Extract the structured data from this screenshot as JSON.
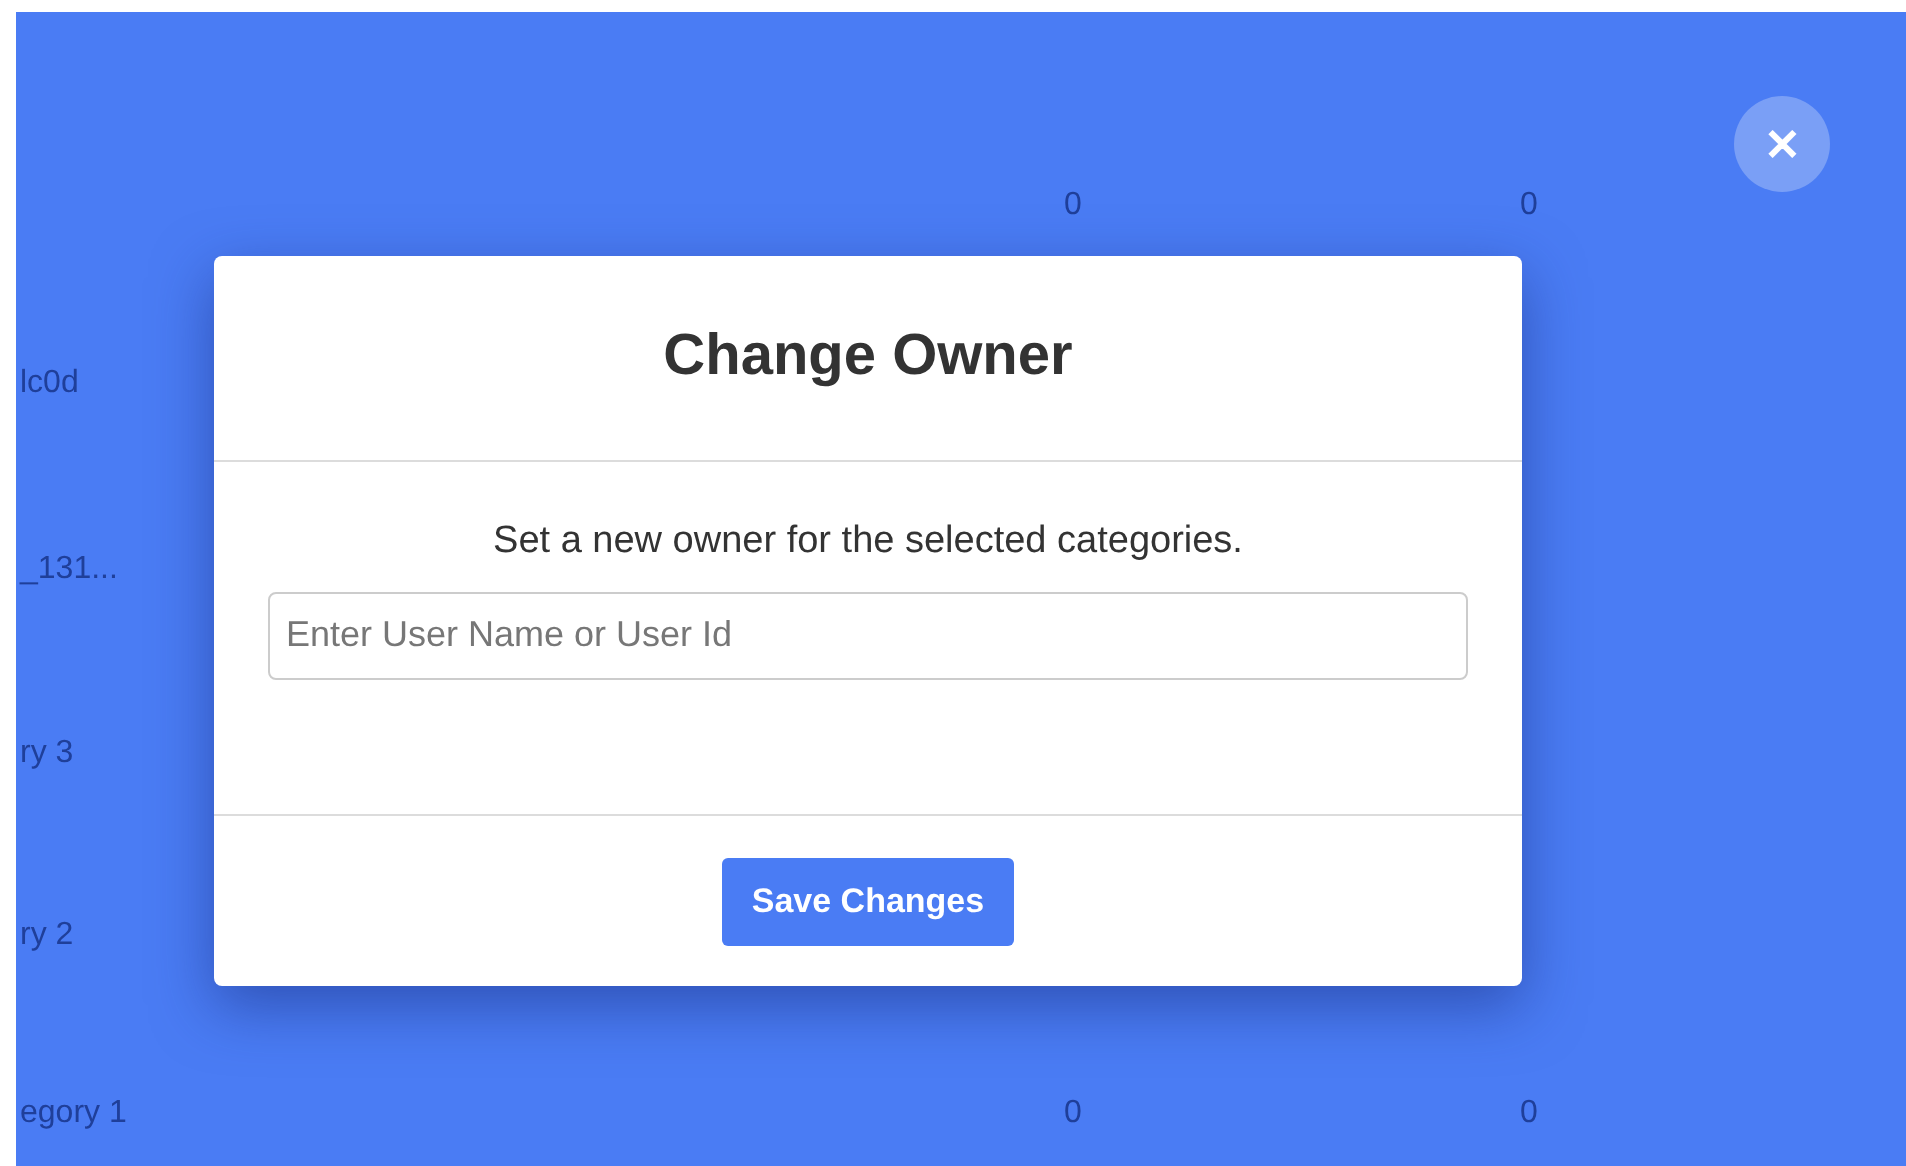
{
  "background_table": {
    "rows": [
      {
        "cells": [
          "",
          "0",
          "0"
        ]
      },
      {
        "cells": [
          "lc0d",
          "",
          ""
        ]
      },
      {
        "cells": [
          "_131...",
          "",
          ""
        ]
      },
      {
        "cells": [
          "ry 3",
          "",
          ""
        ]
      },
      {
        "cells": [
          "ry 2",
          "",
          ""
        ]
      },
      {
        "cells": [
          "egory 1",
          "0",
          "0"
        ]
      }
    ]
  },
  "close_button": {
    "label": "✕"
  },
  "dialog": {
    "title": "Change Owner",
    "message": "Set a new owner for the selected categories.",
    "field": {
      "placeholder": "Enter User Name or User Id"
    },
    "buttons": [
      "Save Changes"
    ]
  }
}
